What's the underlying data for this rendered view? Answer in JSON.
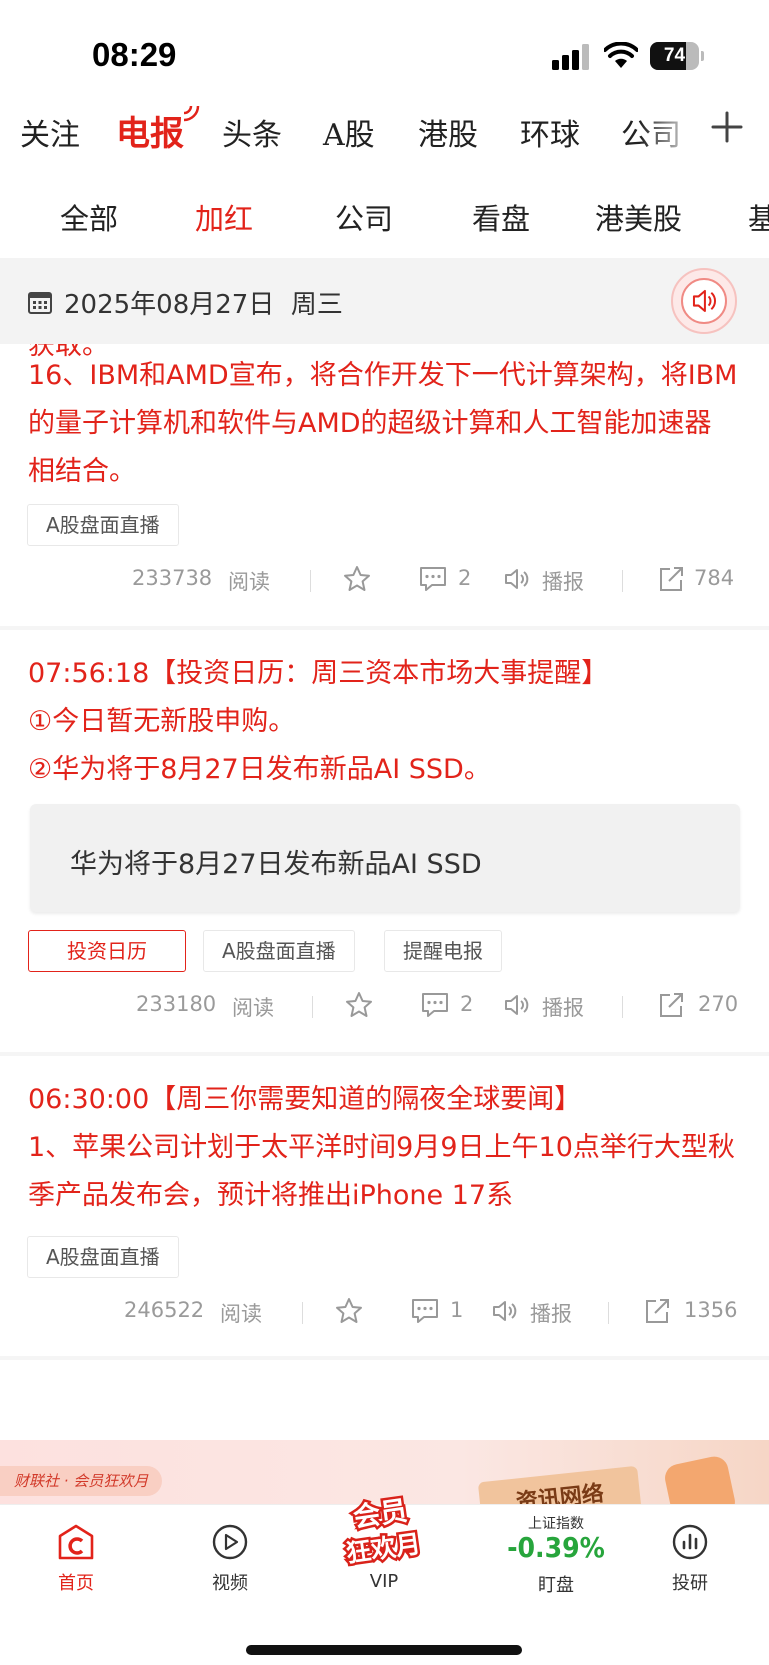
{
  "status_bar": {
    "time": "08:29",
    "battery": "74",
    "battery_level": 0.74
  },
  "top_tabs": [
    "关注",
    "电报",
    "头条",
    "A股",
    "港股",
    "环球",
    "公司"
  ],
  "sub_tabs": [
    "全部",
    "加红",
    "公司",
    "看盘",
    "港美股",
    "基"
  ],
  "date_bar": {
    "date": "2025年08月27日  周三"
  },
  "articles": [
    {
      "partial_top": "获取。",
      "body": "16、IBM和AMD宣布，将合作开发下一代计算架构，将IBM的量子计算机和软件与AMD的超级计算和人工智能加速器相结合。",
      "tags": [
        "A股盘面直播"
      ],
      "reads": "233738",
      "reads_label": "阅读",
      "comments": "2",
      "broadcast": "播报",
      "shares": "784"
    },
    {
      "time": "07:56:18",
      "title": "【投资日历：周三资本市场大事提醒】",
      "lines": [
        "①今日暂无新股申购。",
        "②华为将于8月27日发布新品AI SSD。"
      ],
      "quote": "华为将于8月27日发布新品AI SSD",
      "tags": [
        "投资日历",
        "A股盘面直播",
        "提醒电报"
      ],
      "reads": "233180",
      "reads_label": "阅读",
      "comments": "2",
      "broadcast": "播报",
      "shares": "270"
    },
    {
      "time": "06:30:00",
      "title": "【周三你需要知道的隔夜全球要闻】",
      "body": "1、苹果公司计划于太平洋时间9月9日上午10点举行大型秋季产品发布会，预计将推出iPhone 17系",
      "tags": [
        "A股盘面直播"
      ],
      "reads": "246522",
      "reads_label": "阅读",
      "comments": "1",
      "broadcast": "播报",
      "shares": "1356"
    }
  ],
  "banner": {
    "label": "财联社 · 会员狂欢月",
    "card_text": "资讯网络"
  },
  "bottom_nav": {
    "home": "首页",
    "video": "视频",
    "vip": "VIP",
    "vip_logo": "会员狂欢月",
    "index_name": "上证指数",
    "index_value": "-0.39%",
    "watch": "盯盘",
    "research": "投研"
  },
  "colors": {
    "accent": "#e2231a",
    "down": "#27a53c"
  }
}
